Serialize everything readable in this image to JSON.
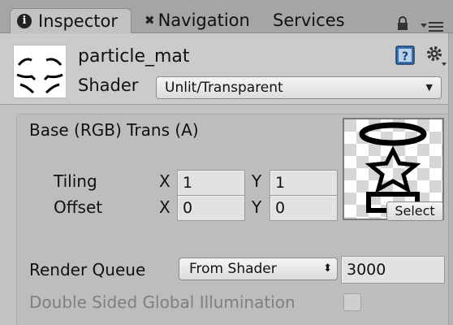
{
  "tabs": {
    "inspector": "Inspector",
    "navigation": "Navigation",
    "services": "Services"
  },
  "material": {
    "name": "particle_mat",
    "shader_label": "Shader",
    "shader_value": "Unlit/Transparent"
  },
  "properties": {
    "base_label": "Base (RGB) Trans (A)",
    "tiling_label": "Tiling",
    "offset_label": "Offset",
    "x_label": "X",
    "y_label": "Y",
    "tiling_x": "1",
    "tiling_y": "1",
    "offset_x": "0",
    "offset_y": "0",
    "select_label": "Select",
    "render_queue_label": "Render Queue",
    "render_queue_mode": "From Shader",
    "render_queue_value": "3000",
    "dsgi_label": "Double Sided Global Illumination",
    "dsgi_checked": false
  },
  "icons": {
    "tab_inspector": "info-icon",
    "tab_navigation": "navigation-icon",
    "lock": "lock-icon",
    "menu": "menu-icon",
    "help": "book-icon",
    "settings": "gear-icon"
  },
  "colors": {
    "panel_bg": "#c2c2c2",
    "tabbar_bg": "#a5a5a5",
    "field_bg": "#e2e2e2",
    "disabled_text": "#7f7f7f"
  }
}
